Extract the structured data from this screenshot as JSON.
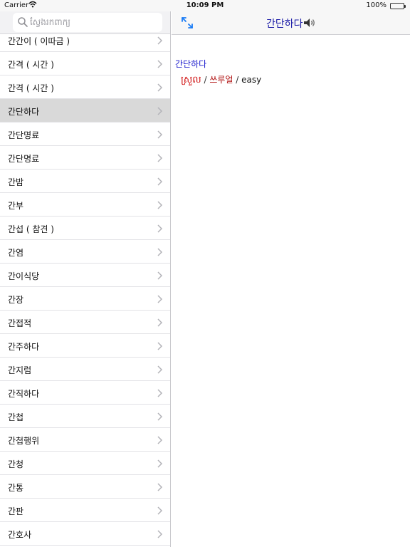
{
  "status_bar": {
    "carrier": "Carrier",
    "time": "10:09 PM",
    "battery": "100%",
    "battery_level": 1.0
  },
  "search": {
    "placeholder": "ស្វែងរកពាក្យ",
    "value": ""
  },
  "list": {
    "items": [
      {
        "label": "간간이 ( 이따금 )",
        "selected": false
      },
      {
        "label": "간격 ( 시간 )",
        "selected": false
      },
      {
        "label": "간격 ( 시간 )",
        "selected": false
      },
      {
        "label": "간단하다",
        "selected": true
      },
      {
        "label": "간단명료",
        "selected": false
      },
      {
        "label": "간단명료",
        "selected": false
      },
      {
        "label": "간밤",
        "selected": false
      },
      {
        "label": "간부",
        "selected": false
      },
      {
        "label": "간섭 ( 참견 )",
        "selected": false
      },
      {
        "label": "간염",
        "selected": false
      },
      {
        "label": "간이식당",
        "selected": false
      },
      {
        "label": "간장",
        "selected": false
      },
      {
        "label": "간접적",
        "selected": false
      },
      {
        "label": "간주하다",
        "selected": false
      },
      {
        "label": "간지럼",
        "selected": false
      },
      {
        "label": "간직하다",
        "selected": false
      },
      {
        "label": "간첩",
        "selected": false
      },
      {
        "label": "간첩행위",
        "selected": false
      },
      {
        "label": "간청",
        "selected": false
      },
      {
        "label": "간통",
        "selected": false
      },
      {
        "label": "간판",
        "selected": false
      },
      {
        "label": "간호사",
        "selected": false
      }
    ]
  },
  "detail": {
    "nav_title": "간단하다",
    "entry_word": "간단하다",
    "khmer": "ស្រួល",
    "separator1": " / ",
    "korean": "쓰루얼",
    "separator2": " /   ",
    "english": "easy"
  },
  "icons": {
    "search": "search-icon",
    "chevron": "chevron-right-icon",
    "expand": "expand-arrows-icon",
    "speaker": "speaker-icon",
    "wifi": "wifi-icon",
    "battery": "battery-icon"
  },
  "colors": {
    "accent": "#1a7cf5",
    "title": "#1a1aa6",
    "khmer_text": "#d01010",
    "selected_row": "#d9d9d9"
  }
}
